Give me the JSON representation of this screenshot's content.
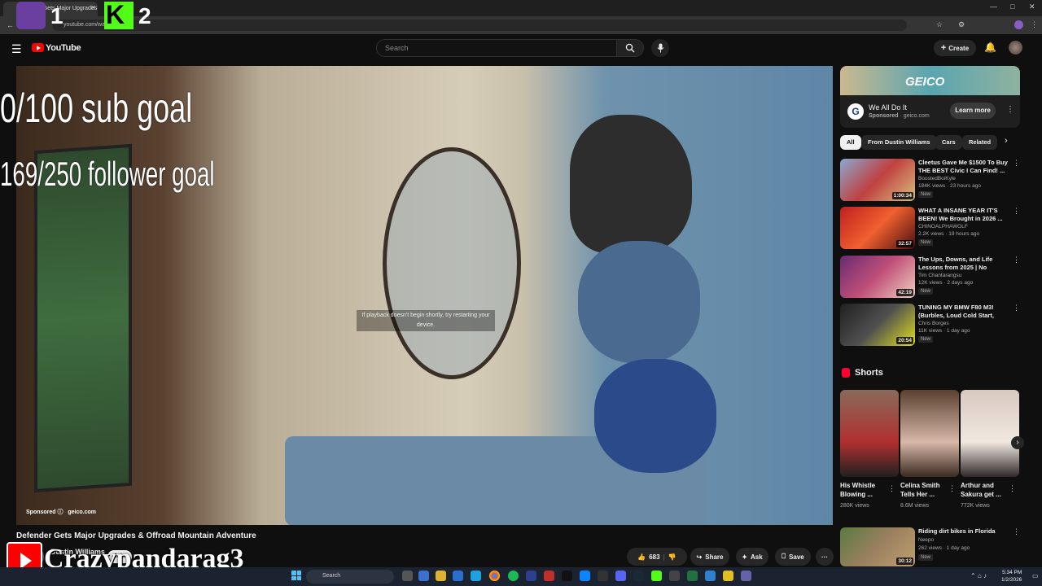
{
  "browser": {
    "tab_title": "Defender Gets Major Upgrades",
    "url": "youtube.com/wat...",
    "window_controls": [
      "—",
      "□",
      "✕"
    ]
  },
  "overlay": {
    "badge1_number": "1",
    "badge2_letter": "K",
    "badge2_number": "2",
    "sub_goal": "0/100 sub goal",
    "follower_goal": "169/250 follower goal",
    "streamer_name": "Crazypandarag3"
  },
  "header": {
    "logo_text": "YouTube",
    "search_placeholder": "Search",
    "create_label": "Create"
  },
  "video": {
    "buffer_hint": "If playback doesn't begin shortly, try restarting your device.",
    "sponsored_label": "Sponsored",
    "sponsor_domain": "geico.com",
    "title": "Defender Gets Major Upgrades & Offroad Mountain Adventure",
    "channel": "Dustin Williams",
    "join_label": "Join",
    "likes": "683",
    "share_label": "Share",
    "ask_label": "Ask",
    "save_label": "Save"
  },
  "ad": {
    "banner_text": "GEICO",
    "title": "We All Do It",
    "sponsored": "Sponsored",
    "domain": "geico.com",
    "cta": "Learn more",
    "logo_letter": "G"
  },
  "chips": [
    "All",
    "From Dustin Williams",
    "Cars",
    "Related"
  ],
  "recommendations": [
    {
      "title": "Cleetus Gave Me $1500 To Buy THE BEST Civic I Can Find! ...",
      "channel": "BoostedBoiKyle",
      "meta": "184K views · 23 hours ago",
      "badge": "New",
      "duration": "1:00:34"
    },
    {
      "title": "WHAT A INSANE YEAR IT'S BEEN! We Brought in 2026 ...",
      "channel": "CHINOALPHAWOLF",
      "meta": "2.2K views · 19 hours ago",
      "badge": "New",
      "duration": "32:57"
    },
    {
      "title": "The Ups, Downs, and Life Lessons from 2025 | No Chase...",
      "channel": "Tim Chantarangsu",
      "meta": "12K views · 2 days ago",
      "badge": "New",
      "duration": "42:19"
    },
    {
      "title": "TUNING MY BMW F80 M3! (Burbles, Loud Cold Start, Stag...",
      "channel": "Chris Borges",
      "meta": "11K views · 1 day ago",
      "badge": "New",
      "duration": "20:54"
    }
  ],
  "shorts": {
    "heading": "Shorts",
    "items": [
      {
        "title": "His Whistle Blowing ...",
        "views": "280K views"
      },
      {
        "title": "Celina Smith Tells Her ...",
        "views": "8.6M views"
      },
      {
        "title": "Arthur and Sakura get ...",
        "views": "772K views"
      }
    ]
  },
  "rec_after_shorts": {
    "title": "Riding dirt bikes in Florida",
    "channel": "Neepo",
    "meta": "262 views · 1 day ago",
    "badge": "New",
    "duration": "30:12"
  },
  "taskbar": {
    "search_label": "Search",
    "time": "5:34 PM",
    "date": "1/2/2026"
  },
  "colors": {
    "yt_red": "#ff0000",
    "kick_green": "#53fc18",
    "twitch_purple": "#6a3fa0"
  }
}
